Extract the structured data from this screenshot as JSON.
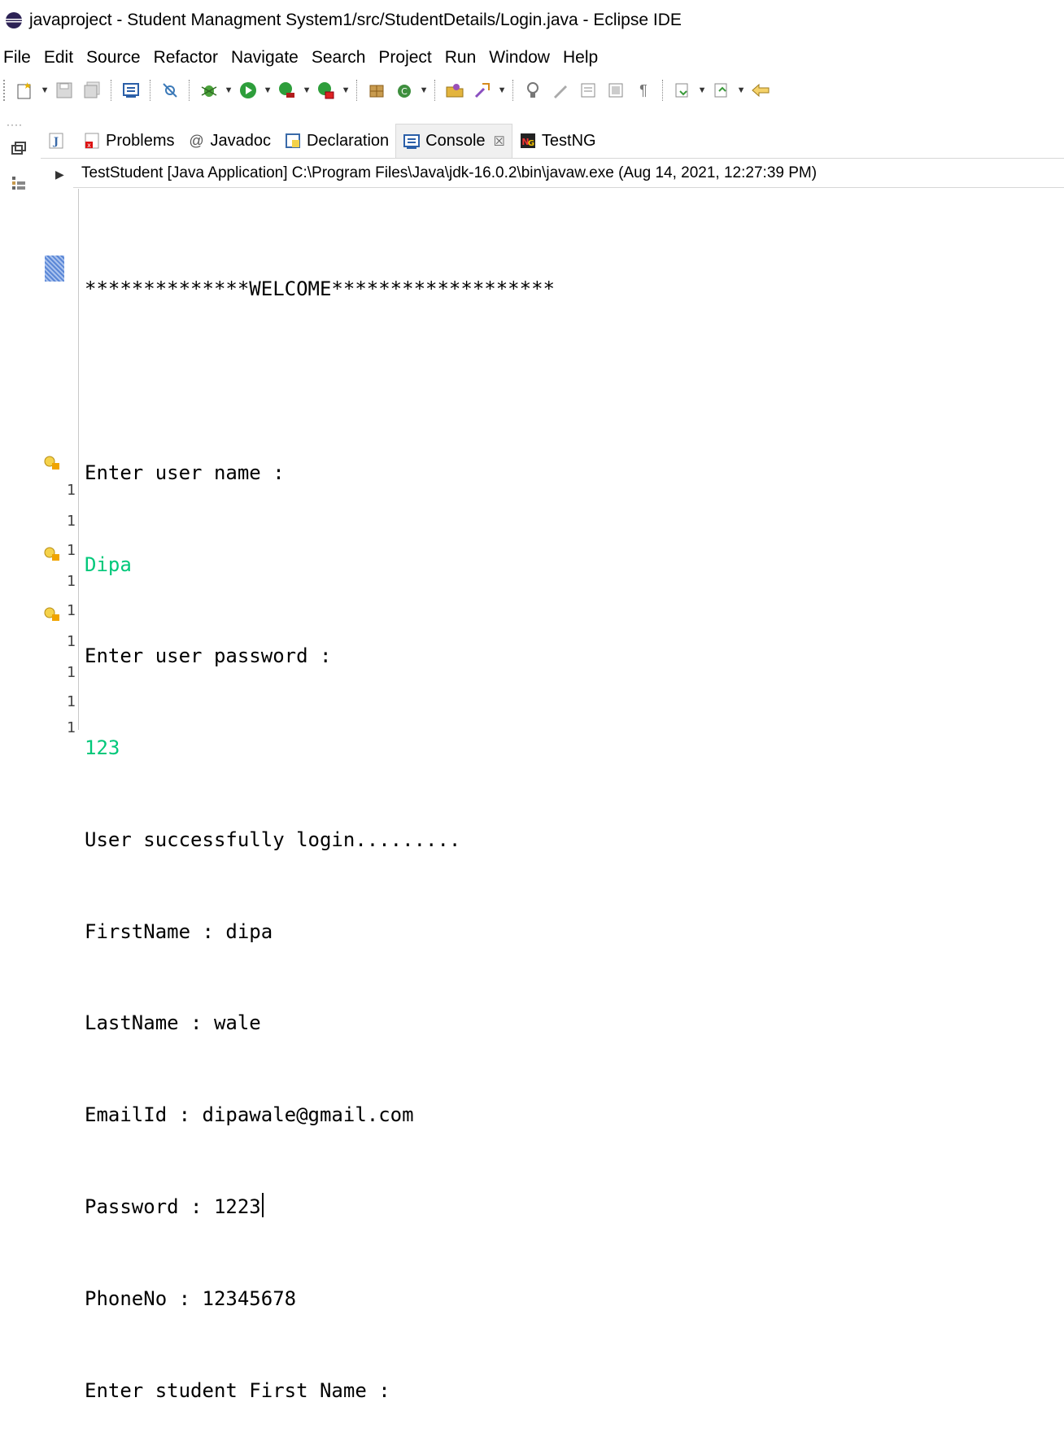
{
  "window": {
    "title": "javaproject - Student Managment System1/src/StudentDetails/Login.java - Eclipse IDE"
  },
  "menubar": {
    "items": [
      "File",
      "Edit",
      "Source",
      "Refactor",
      "Navigate",
      "Search",
      "Project",
      "Run",
      "Window",
      "Help"
    ]
  },
  "toolbar": {
    "icons": [
      "new-icon",
      "save-icon",
      "save-all-icon",
      "console-icon",
      "skip-breakpoints-icon",
      "debug-icon",
      "run-icon",
      "run-external-icon",
      "coverage-icon",
      "new-java-package-icon",
      "new-java-class-icon",
      "open-type-icon",
      "search-icon",
      "annotation-icon",
      "edit-icon",
      "block-selection-icon",
      "show-whitespace-icon",
      "pilcrow-icon",
      "next-annotation-icon",
      "prev-annotation-icon",
      "back-icon"
    ]
  },
  "tabs": [
    {
      "label": "Problems",
      "icon": "problems-icon",
      "active": false
    },
    {
      "label": "Javadoc",
      "icon": "javadoc-icon",
      "active": false
    },
    {
      "label": "Declaration",
      "icon": "declaration-icon",
      "active": false
    },
    {
      "label": "Console",
      "icon": "console-icon",
      "active": true,
      "close": "☒"
    },
    {
      "label": "TestNG",
      "icon": "testng-icon",
      "active": false
    }
  ],
  "launch": {
    "text": "TestStudent [Java Application] C:\\Program Files\\Java\\jdk-16.0.2\\bin\\javaw.exe  (Aug 14, 2021, 12:27:39 PM)"
  },
  "console": {
    "welcome": "**************WELCOME*******************",
    "lines": [
      {
        "text": "Enter user name :",
        "type": "output"
      },
      {
        "text": "Dipa",
        "type": "input"
      },
      {
        "text": "Enter user password :",
        "type": "output"
      },
      {
        "text": "123",
        "type": "input"
      },
      {
        "text": "User successfully login.........",
        "type": "output"
      },
      {
        "text": "FirstName : dipa",
        "type": "output"
      },
      {
        "text": "LastName : wale",
        "type": "output"
      },
      {
        "text": "EmailId : dipawale@gmail.com",
        "type": "output"
      },
      {
        "text": "Password : 1223",
        "type": "output"
      },
      {
        "text": "PhoneNo : 12345678",
        "type": "output"
      },
      {
        "text": "Enter student First Name :",
        "type": "output"
      }
    ]
  },
  "gutter": {
    "numbers": [
      "1",
      "1",
      "1",
      "1",
      "1",
      "1",
      "1",
      "1",
      "1"
    ]
  },
  "colors": {
    "input_text": "#00c87a",
    "active_tab": "#f0f0f0"
  }
}
